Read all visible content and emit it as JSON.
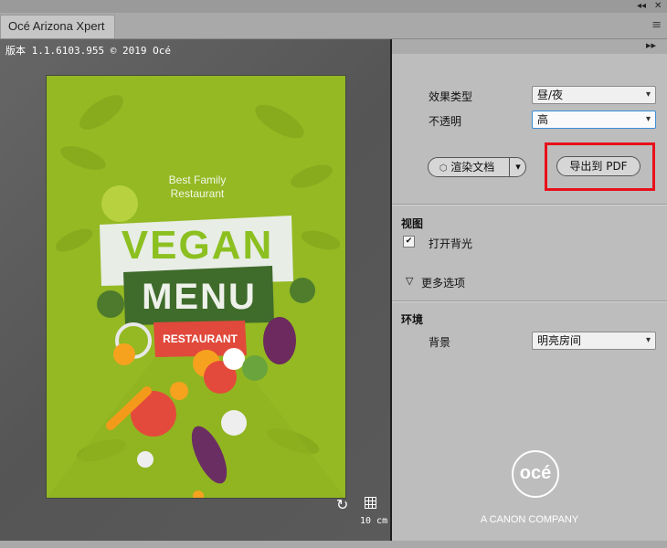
{
  "window": {
    "collapse_label": "◂◂",
    "close_label": "✕",
    "tab_title": "Océ Arizona Xpert",
    "menu_label": "≡"
  },
  "preview": {
    "version_text": "版本 1.1.6103.955 © 2019 Océ",
    "scale_text": "10 cm",
    "poster": {
      "subtitle_line1": "Best Family",
      "subtitle_line2": "Restaurant",
      "title_line1": "VEGAN",
      "title_line2": "MENU",
      "tag": "RESTAURANT"
    }
  },
  "panel": {
    "expand_label": "▸▸",
    "effect_type_label": "效果类型",
    "effect_type_value": "昼/夜",
    "opacity_label": "不透明",
    "opacity_value": "高",
    "render_button_label": "渲染文档",
    "export_button_label": "导出到 PDF",
    "view_section_title": "视图",
    "backlight_label": "打开背光",
    "backlight_checked": true,
    "more_options_label": "更多选项",
    "environment_section_title": "环境",
    "background_label": "背景",
    "background_value": "明亮房间",
    "brand_logo_text": "océ",
    "brand_tagline": "A CANON COMPANY"
  },
  "colors": {
    "poster_bg": "#94b923",
    "menu_band": "#4a6f2c",
    "tag_red": "#e0493b",
    "highlight": "#e8101a"
  }
}
